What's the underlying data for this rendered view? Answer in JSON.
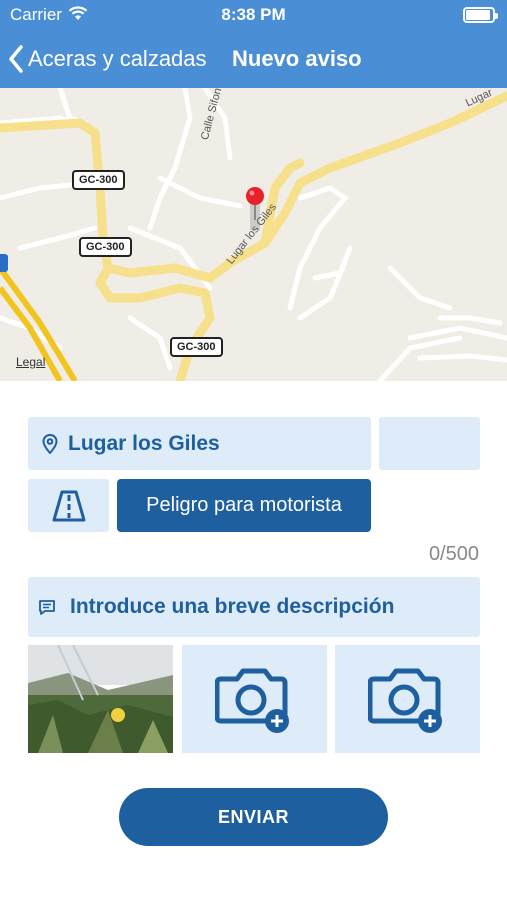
{
  "status_bar": {
    "carrier": "Carrier",
    "time": "8:38 PM",
    "icons": [
      "wifi-icon",
      "battery-icon"
    ]
  },
  "nav": {
    "back_label": "Aceras y calzadas",
    "title": "Nuevo aviso"
  },
  "map": {
    "road_shields": [
      "GC-300",
      "GC-300",
      "GC-300"
    ],
    "street_labels": [
      "Lugar los Giles",
      "Calle Sifon",
      "Lugar"
    ],
    "legal": "Legal",
    "pin_icon": "map-pin-icon"
  },
  "form": {
    "location": "Lugar los Giles",
    "location_icon": "location-pin-icon",
    "category_icon": "road-icon",
    "category": "Peligro para motorista",
    "counter": "0/500",
    "description_placeholder": "Introduce una breve descripción",
    "description_icon": "comment-icon",
    "photo_slots": [
      "photo-thumbnail",
      "add-photo-camera-icon",
      "add-photo-camera-icon"
    ],
    "send_label": "ENVIAR"
  },
  "colors": {
    "header": "#4a8fd6",
    "primary": "#1e5fa0",
    "field_bg": "#deebf8"
  }
}
